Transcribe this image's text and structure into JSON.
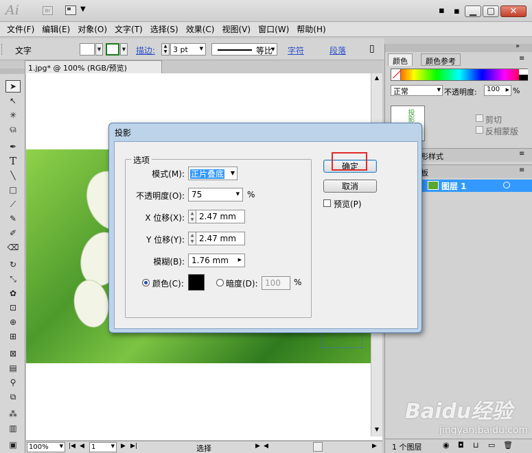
{
  "app": {
    "logo": "Ai",
    "bridge": "Br"
  },
  "menu": [
    "文件(F)",
    "编辑(E)",
    "对象(O)",
    "文字(T)",
    "选择(S)",
    "效果(C)",
    "视图(V)",
    "窗口(W)",
    "帮助(H)"
  ],
  "control_bar": {
    "label": "文字",
    "stroke_label": "描边:",
    "stroke_weight": "3 pt",
    "profile": "等比",
    "char_link": "字符",
    "para_link": "段落"
  },
  "document": {
    "tab": "1.jpg* @ 100% (RGB/预览)",
    "zoom": "100%",
    "page": "1",
    "status": "选择"
  },
  "panels": {
    "color_tab": "颜色",
    "color_ref_tab": "颜色参考",
    "blend_mode": "正常",
    "opacity_label": "不透明度:",
    "opacity_value": "100",
    "opacity_unit": "%",
    "clip_label": "剪切",
    "invert_label": "反相蒙版",
    "graphic_styles_tab": "形样式",
    "layers_tab": "板",
    "layer_name": "图层 1",
    "layer_count": "1 个图层"
  },
  "dialog": {
    "title": "投影",
    "group_label": "选项",
    "mode_label": "模式(M):",
    "mode_value": "正片叠底",
    "opacity_label": "不透明度(O):",
    "opacity_value": "75",
    "opacity_unit": "%",
    "x_label": "X 位移(X):",
    "x_value": "2.47 mm",
    "y_label": "Y 位移(Y):",
    "y_value": "2.47 mm",
    "blur_label": "模糊(B):",
    "blur_value": "1.76 mm",
    "color_label": "颜色(C):",
    "darkness_label": "暗度(D):",
    "darkness_value": "100",
    "darkness_unit": "%",
    "ok_label": "确定",
    "cancel_label": "取消",
    "preview_label": "预览(P)"
  },
  "watermark": {
    "brand": "Baidu经验",
    "url": "jingyan.baidu.com"
  },
  "colors": {
    "highlight": "#e0282a",
    "shadow_color": "#000000",
    "selection_blue": "#3399ff"
  }
}
